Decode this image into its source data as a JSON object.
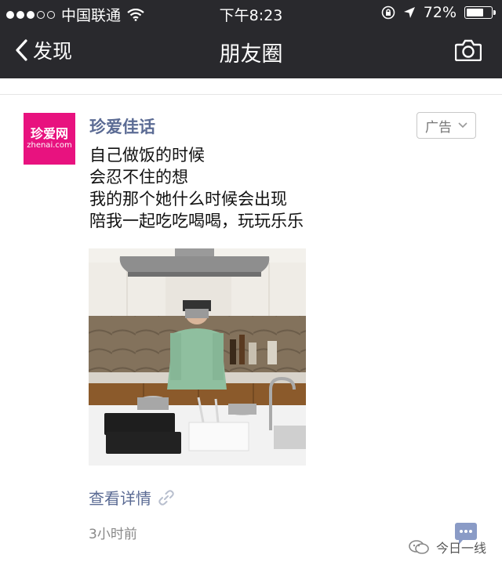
{
  "status_bar": {
    "carrier": "中国联通",
    "time": "下午8:23",
    "battery": "72%",
    "battery_level": 0.72,
    "signal_dots_filled": 3,
    "signal_dots_total": 5
  },
  "nav": {
    "back_label": "发现",
    "title": "朋友圈",
    "camera_icon": "camera-icon"
  },
  "post": {
    "author": "珍爱佳话",
    "avatar": {
      "brand": "珍爱网",
      "domain": "zhenai.com",
      "color": "#e8127f"
    },
    "ad_label": "广告",
    "lines": [
      "自己做饭的时候",
      "会忍不住的想",
      "我的那个她什么时候会出现",
      "陪我一起吃吃喝喝，玩玩乐乐"
    ],
    "detail_link": "查看详情",
    "time_ago": "3小时前"
  },
  "watermark": {
    "text": "今日一线"
  }
}
